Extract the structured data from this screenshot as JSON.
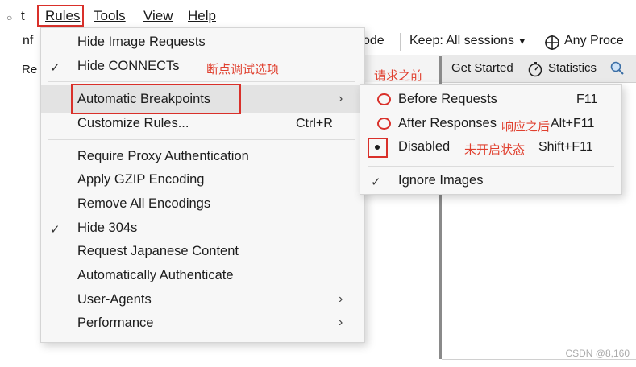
{
  "menubar": {
    "cut_item": "t",
    "items": [
      {
        "label": "Rules"
      },
      {
        "label": "Tools"
      },
      {
        "label": "View"
      },
      {
        "label": "Help"
      }
    ]
  },
  "toolbar": {
    "cut_left": "nf",
    "cut_mode": "ode",
    "keep": "Keep: All sessions",
    "process": "Any Proce"
  },
  "tabs": {
    "left_cut": "Re",
    "get_started": "Get Started",
    "statistics": "Statistics"
  },
  "rules_menu": {
    "items": [
      {
        "label": "Hide Image Requests",
        "checked": false
      },
      {
        "label": "Hide CONNECTs",
        "checked": true
      },
      {
        "label": "Automatic Breakpoints",
        "submenu": true
      },
      {
        "label": "Customize Rules...",
        "shortcut": "Ctrl+R"
      },
      {
        "label": "Require Proxy Authentication"
      },
      {
        "label": "Apply GZIP Encoding"
      },
      {
        "label": "Remove All Encodings"
      },
      {
        "label": "Hide 304s",
        "checked": true
      },
      {
        "label": "Request Japanese Content"
      },
      {
        "label": "Automatically Authenticate"
      },
      {
        "label": "User-Agents",
        "submenu": true
      },
      {
        "label": "Performance",
        "submenu": true
      }
    ]
  },
  "breakpoints_submenu": {
    "items": [
      {
        "label": "Before Requests",
        "shortcut": "F11"
      },
      {
        "label": "After Responses",
        "shortcut": "Alt+F11"
      },
      {
        "label": "Disabled",
        "shortcut": "Shift+F11",
        "selected": true
      },
      {
        "label": "Ignore Images",
        "checked": true
      }
    ]
  },
  "annotations": {
    "breakpoint_options": "断点调试选项",
    "before_request": "请求之前",
    "after_response": "响应之后",
    "not_enabled": "未开启状态"
  },
  "watermark": "CSDN @8,160"
}
